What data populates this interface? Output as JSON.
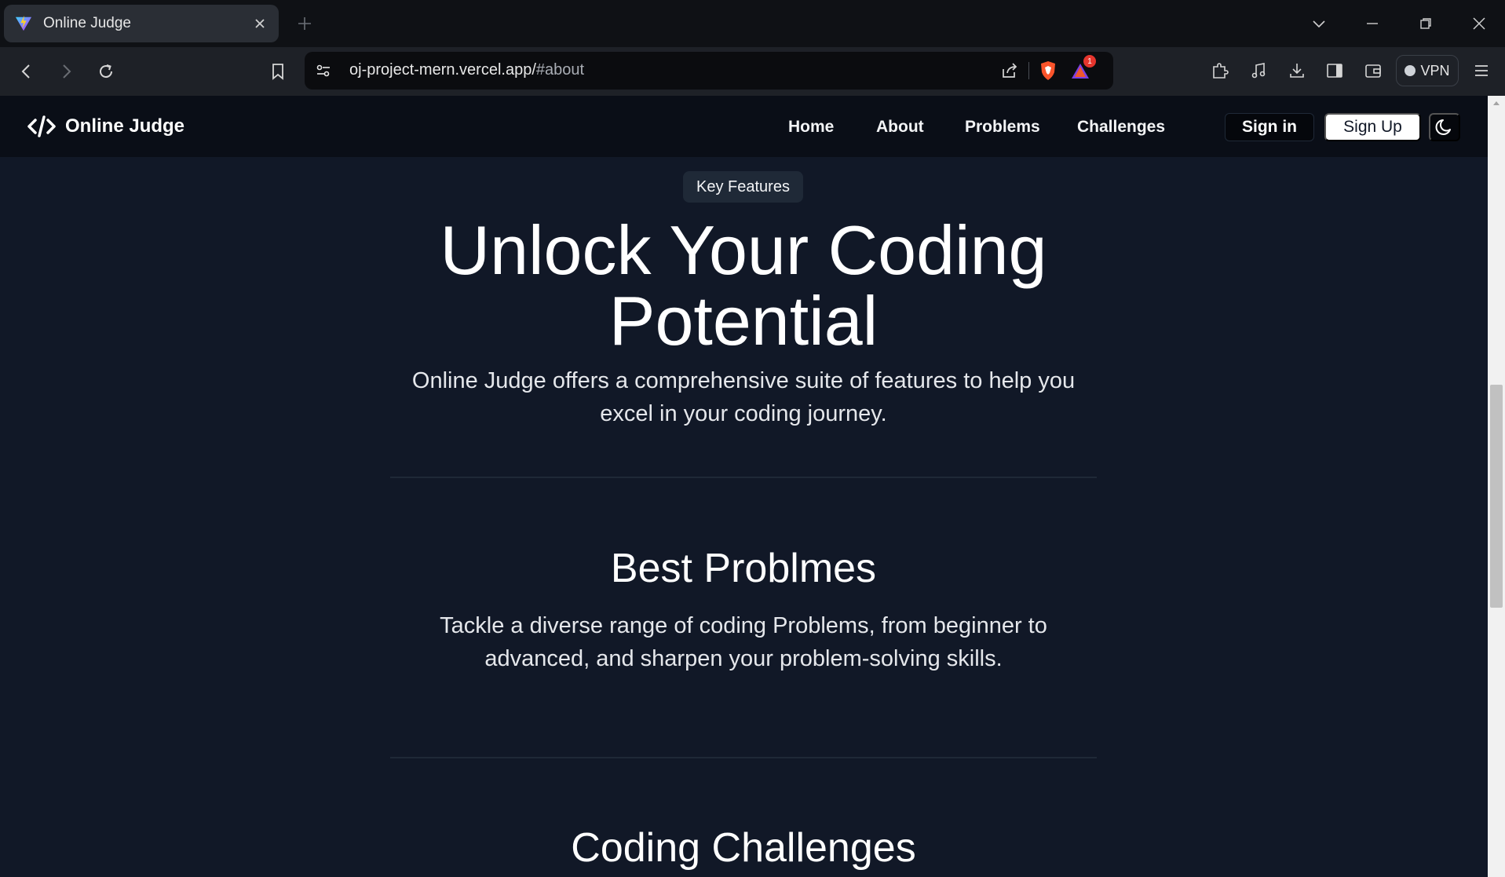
{
  "browser": {
    "tab_title": "Online Judge",
    "url_host": "oj-project-mern.vercel.app/",
    "url_path": "#about",
    "vpn_label": "VPN",
    "notification_count": "1"
  },
  "navbar": {
    "brand": "Online Judge",
    "links": [
      "Home",
      "About",
      "Problems",
      "Challenges"
    ],
    "signin_label": "Sign in",
    "signup_label": "Sign Up"
  },
  "hero": {
    "badge": "Key Features",
    "title": "Unlock Your Coding Potential",
    "subtitle": "Online Judge offers a comprehensive suite of features to help you excel in your coding journey."
  },
  "features": [
    {
      "title": "Best Problmes",
      "description": "Tackle a diverse range of coding Problems, from beginner to advanced, and sharpen your problem-solving skills."
    },
    {
      "title": "Coding Challenges"
    }
  ],
  "colors": {
    "page_bg": "#111827",
    "navbar_bg": "#0a0e17",
    "badge_bg": "#1f2937",
    "brave_orange": "#fb542b"
  }
}
